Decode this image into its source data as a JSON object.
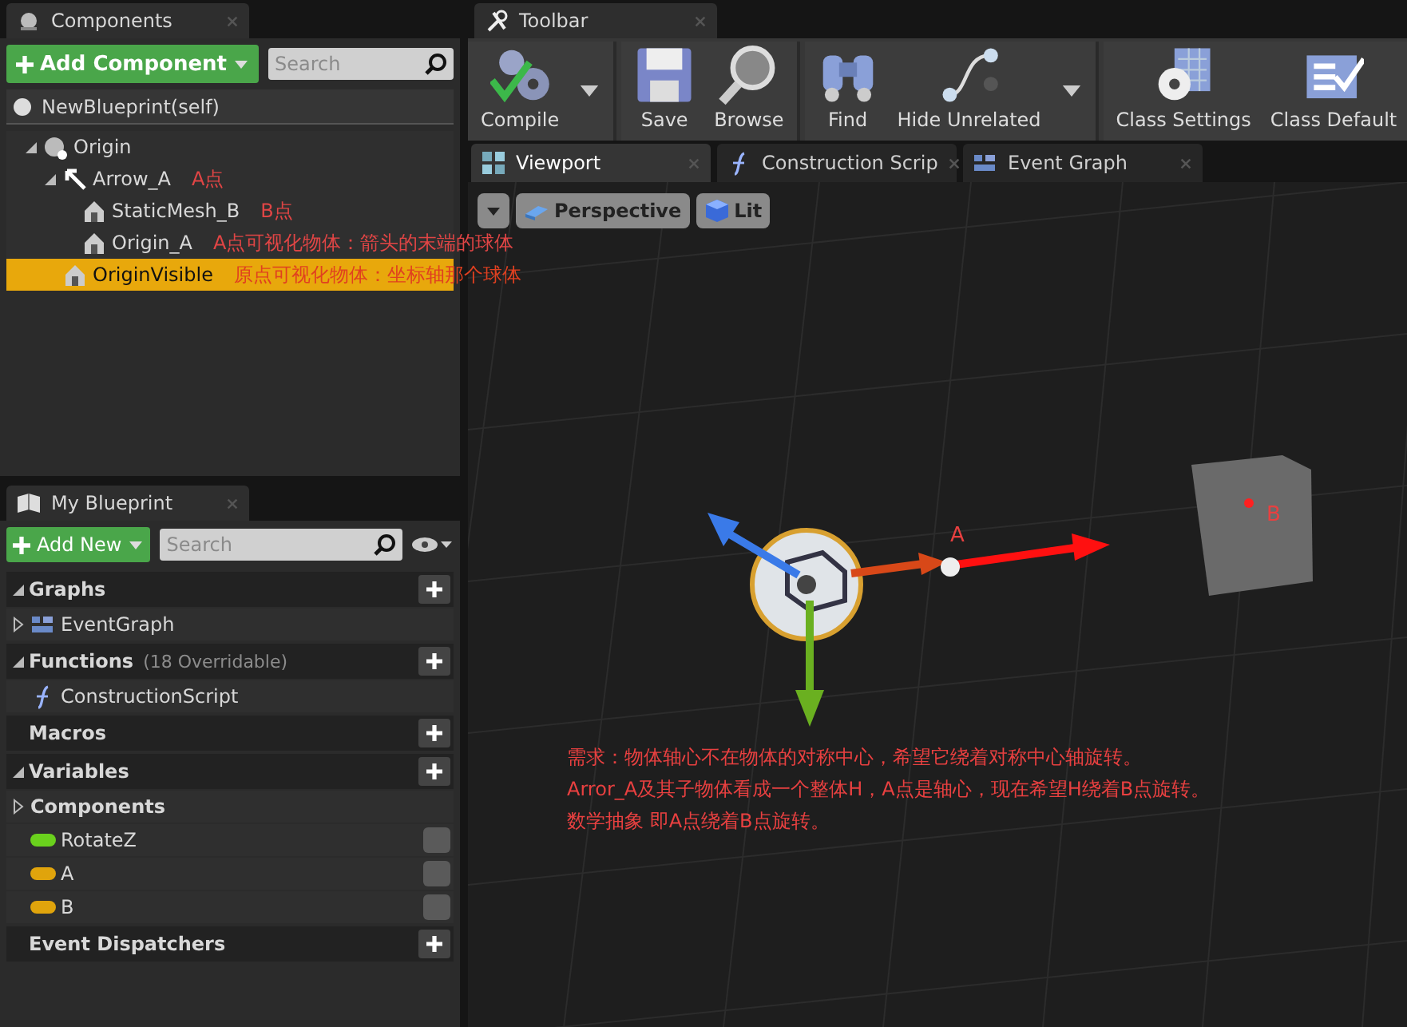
{
  "components_panel": {
    "tab": "Components",
    "add_button": "Add Component",
    "search": {
      "placeholder": "Search"
    },
    "self_item": "NewBlueprint(self)",
    "tree": [
      {
        "name": "Origin",
        "kind": "scene",
        "expanded": true,
        "selected": false,
        "children": [
          {
            "name": "Arrow_A",
            "kind": "arrow",
            "note": "A点",
            "expanded": true,
            "selected": false,
            "children": [
              {
                "name": "StaticMesh_B",
                "kind": "mesh",
                "note": "B点",
                "selected": false
              },
              {
                "name": "Origin_A",
                "kind": "mesh",
                "note": "A点可视化物体：箭头的末端的球体",
                "selected": false
              }
            ]
          },
          {
            "name": "OriginVisible",
            "kind": "mesh",
            "note": "原点可视化物体：坐标轴那个球体",
            "selected": true
          }
        ]
      }
    ]
  },
  "blueprint_panel": {
    "tab": "My Blueprint",
    "add_button": "Add New",
    "search": {
      "placeholder": "Search"
    },
    "sections": [
      {
        "title": "Graphs",
        "expanded": true,
        "items": [
          {
            "name": "EventGraph",
            "kind": "graph",
            "expanded": false
          }
        ]
      },
      {
        "title": "Functions",
        "note": "(18 Overridable)",
        "expanded": true,
        "items": [
          {
            "name": "ConstructionScript",
            "kind": "function"
          }
        ]
      },
      {
        "title": "Macros"
      },
      {
        "title": "Variables",
        "expanded": true,
        "items": [
          {
            "name": "Components",
            "kind": "category",
            "expanded": false
          },
          {
            "name": "RotateZ",
            "kind": "variable",
            "color": "#6ad11d"
          },
          {
            "name": "A",
            "kind": "variable",
            "color": "#e0a40c"
          },
          {
            "name": "B",
            "kind": "variable",
            "color": "#e0a40c"
          }
        ]
      },
      {
        "title": "Event Dispatchers"
      }
    ]
  },
  "toolbar": {
    "tab": "Toolbar",
    "groups": [
      [
        {
          "label": "Compile",
          "kind": "compile",
          "dropdown": true
        }
      ],
      [
        {
          "label": "Save",
          "kind": "save"
        },
        {
          "label": "Browse",
          "kind": "browse"
        }
      ],
      [
        {
          "label": "Find",
          "kind": "find"
        },
        {
          "label": "Hide Unrelated",
          "kind": "hide",
          "dropdown": true
        }
      ],
      [
        {
          "label": "Class Settings",
          "kind": "settings"
        },
        {
          "label": "Class Default",
          "kind": "defaults"
        }
      ]
    ]
  },
  "editor_tabs": [
    {
      "label": "Viewport",
      "kind": "viewport",
      "selected": true
    },
    {
      "label": "Construction Scrip",
      "kind": "function",
      "selected": false
    },
    {
      "label": "Event Graph",
      "kind": "graph",
      "selected": false
    }
  ],
  "viewport": {
    "buttons": [
      {
        "label": "Perspective",
        "kind": "perspective"
      },
      {
        "label": "Lit",
        "kind": "lit"
      }
    ],
    "labels": [
      {
        "text": "A",
        "kind": "arrow_end"
      },
      {
        "text": "B",
        "kind": "cube"
      }
    ],
    "notes": [
      "需求：物体轴心不在物体的对称中心，希望它绕着对称中心轴旋转。",
      "Arror_A及其子物体看成一个整体H，A点是轴心，现在希望H绕着B点旋转。",
      "数学抽象 即A点绕着B点旋转。"
    ]
  }
}
